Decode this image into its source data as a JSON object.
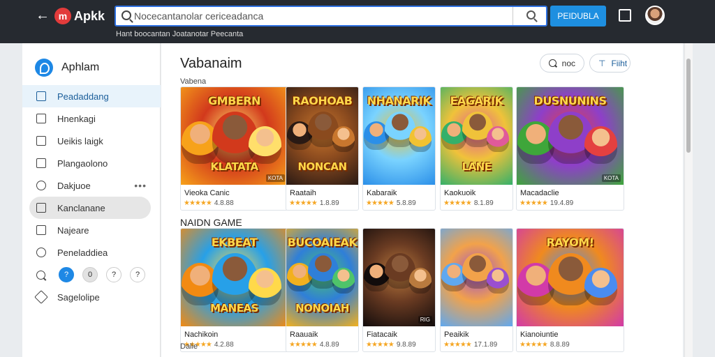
{
  "header": {
    "logo_badge": "m",
    "logo_text": "Apkk",
    "search_value": "Nocecantanolar cericeadanca",
    "primary_button": "PEIDUBLA",
    "subnav": "Hant boocantan Joatanotar Peecanta"
  },
  "sidebar": {
    "title": "Aphlam",
    "items": [
      {
        "label": "Peadaddang",
        "icon": "home-icon"
      },
      {
        "label": "Hnenkagi",
        "icon": "grid-icon"
      },
      {
        "label": "Ueikis laigk",
        "icon": "library-icon"
      },
      {
        "label": "Plangaolono",
        "icon": "bookmark-icon"
      },
      {
        "label": "Dakjuoe",
        "icon": "shield-icon",
        "more": "•••"
      },
      {
        "label": "Kanclanane",
        "icon": "folder-icon"
      },
      {
        "label": "Najeare",
        "icon": "tag-icon"
      },
      {
        "label": "Peneladdiea",
        "icon": "clock-icon"
      }
    ],
    "quick_pills": [
      "?",
      "0",
      "?",
      "?"
    ],
    "bottom_item": "Sagelolipe"
  },
  "main": {
    "title": "Vabanaim",
    "section1_label": "Vabena",
    "section2_title": "NAIDN GAME",
    "section3_label": "Dalie",
    "chip_search": "noc",
    "chip_filter": "Fiiht",
    "row1": [
      {
        "name": "Vieoka Canic",
        "rating": "4.8.88",
        "art": "GMBERN",
        "badge": "KOTA",
        "subtitle": "KLATATA"
      },
      {
        "name": "Raataih",
        "rating": "1.8.89",
        "art": "RAOHOAB",
        "badge": "",
        "subtitle": "NONCAN"
      },
      {
        "name": "Kabaraik",
        "rating": "5.8.89",
        "art": "NHANARIK",
        "badge": "",
        "subtitle": ""
      },
      {
        "name": "Kaokuoik",
        "rating": "8.1.89",
        "art": "EAGARIK",
        "badge": "",
        "subtitle": "LANE"
      },
      {
        "name": "Macadaclie",
        "rating": "19.4.89",
        "art": "DUSNUNINS",
        "badge": "KOTA",
        "subtitle": ""
      }
    ],
    "row2": [
      {
        "name": "Nachikoin",
        "rating": "4.2.88",
        "art": "EKBEAT",
        "badge": "",
        "subtitle": "MANEAS"
      },
      {
        "name": "Raauaik",
        "rating": "4.8.89",
        "art": "BUCOAIEAK",
        "badge": "",
        "subtitle": "NONOIAH"
      },
      {
        "name": "Fiatacaik",
        "rating": "9.8.89",
        "art": "",
        "badge": "RIG",
        "subtitle": ""
      },
      {
        "name": "Peaikik",
        "rating": "17.1.89",
        "art": "",
        "badge": "",
        "subtitle": ""
      },
      {
        "name": "Kianoiuntie",
        "rating": "8.8.89",
        "art": "RAYOM!",
        "badge": "",
        "subtitle": ""
      }
    ],
    "stars": "★★★★★"
  },
  "colors": {
    "topbar": "#262a30",
    "accent": "#1e8fe0",
    "brand": "#e23b3b",
    "star": "#f5a623"
  }
}
